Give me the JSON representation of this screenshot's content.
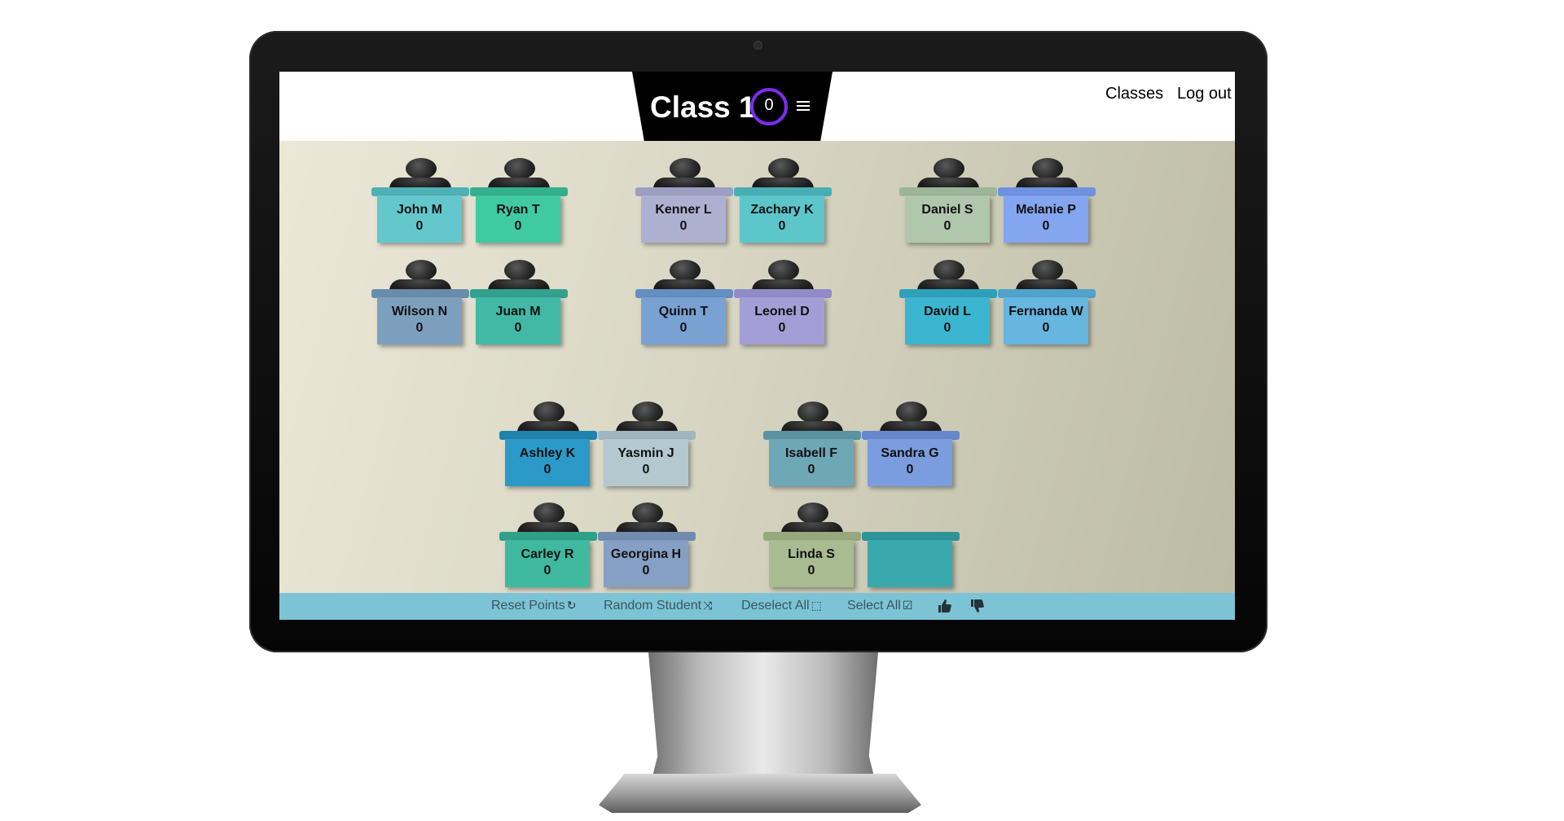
{
  "header": {
    "class_title": "Class 1",
    "class_points": "0",
    "menu_icon": "hamburger-menu-icon",
    "nav_links": [
      "Classes",
      "Log out"
    ]
  },
  "colors": {
    "title_tab": "#000000",
    "points_ring": "#7d2cf0",
    "toolbar_bg": "#7cc4d5"
  },
  "desks": [
    {
      "name": "John M",
      "points": "0",
      "color": "#64c7cc",
      "top_color": "#4fb0b5"
    },
    {
      "name": "Ryan T",
      "points": "0",
      "color": "#3fcaa2",
      "top_color": "#33b08c"
    },
    {
      "name": "Kenner L",
      "points": "0",
      "color": "#aeb0d2",
      "top_color": "#9c9ec2"
    },
    {
      "name": "Zachary K",
      "points": "0",
      "color": "#5cc6cb",
      "top_color": "#47afb4"
    },
    {
      "name": "Daniel S",
      "points": "0",
      "color": "#b0c7ad",
      "top_color": "#9cb498"
    },
    {
      "name": "Melanie P",
      "points": "0",
      "color": "#84a6f0",
      "top_color": "#6e92e0"
    },
    {
      "name": "Wilson N",
      "points": "0",
      "color": "#7d9fbe",
      "top_color": "#6a8cab"
    },
    {
      "name": "Juan M",
      "points": "0",
      "color": "#42b9a5",
      "top_color": "#33a18e"
    },
    {
      "name": "Quinn T",
      "points": "0",
      "color": "#79a2d3",
      "top_color": "#658fc1"
    },
    {
      "name": "Leonel D",
      "points": "0",
      "color": "#a49ed6",
      "top_color": "#928bc6"
    },
    {
      "name": "David L",
      "points": "0",
      "color": "#3cb6d0",
      "top_color": "#2fa0b9"
    },
    {
      "name": "Fernanda W",
      "points": "0",
      "color": "#66b6e0",
      "top_color": "#52a2cc"
    },
    {
      "name": "Ashley K",
      "points": "0",
      "color": "#2b9ac8",
      "top_color": "#2082ad"
    },
    {
      "name": "Yasmin J",
      "points": "0",
      "color": "#b4c8d0",
      "top_color": "#a1b6bf"
    },
    {
      "name": "Isabell F",
      "points": "0",
      "color": "#6ea7b6",
      "top_color": "#5b93a2"
    },
    {
      "name": "Sandra G",
      "points": "0",
      "color": "#7c9ce0",
      "top_color": "#6888cd"
    },
    {
      "name": "Carley R",
      "points": "0",
      "color": "#3fb9a0",
      "top_color": "#30a089"
    },
    {
      "name": "Georgina H",
      "points": "0",
      "color": "#869fc4",
      "top_color": "#738bb1"
    },
    {
      "name": "Linda S",
      "points": "0",
      "color": "#a8bb91",
      "top_color": "#95a87e"
    },
    {
      "name": "",
      "points": "",
      "color": "#3aa9ad",
      "top_color": "#2f9498",
      "empty": true
    }
  ],
  "toolbar": {
    "reset_points": "Reset Points",
    "random_student": "Random Student",
    "deselect_all": "Deselect All",
    "select_all": "Select All",
    "icons": [
      "refresh-icon",
      "shuffle-icon",
      "deselect-icon",
      "checkbox-icon",
      "thumbs-up-icon",
      "thumbs-down-icon"
    ]
  }
}
